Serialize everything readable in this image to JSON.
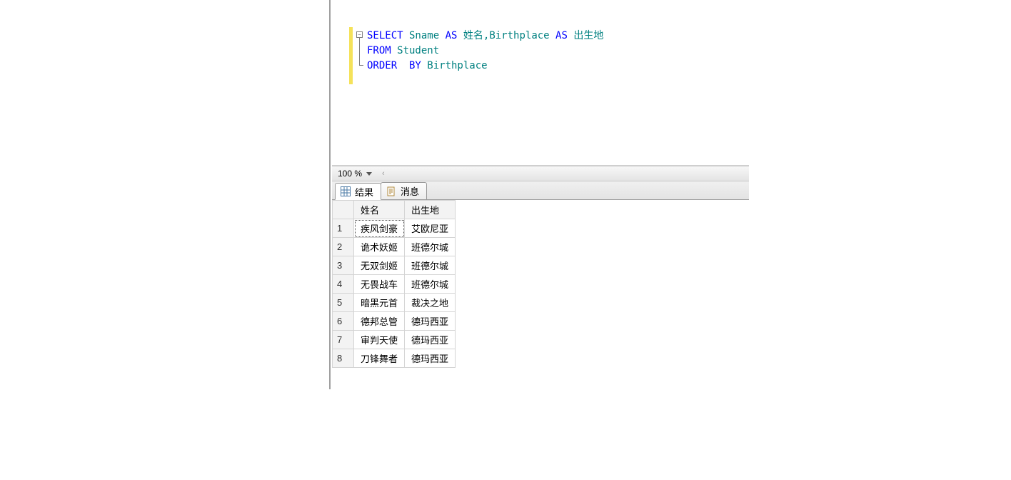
{
  "editor": {
    "fold_glyph": "−",
    "lines": [
      {
        "segments": [
          {
            "t": "SELECT",
            "c": "kw"
          },
          {
            "t": " Sname ",
            "c": "plain"
          },
          {
            "t": "AS",
            "c": "kw"
          },
          {
            "t": " 姓名",
            "c": "plain"
          },
          {
            "t": ",",
            "c": "plain"
          },
          {
            "t": "Birthplace ",
            "c": "plain"
          },
          {
            "t": "AS",
            "c": "kw"
          },
          {
            "t": " 出生地",
            "c": "plain"
          }
        ]
      },
      {
        "segments": [
          {
            "t": "FROM",
            "c": "kw"
          },
          {
            "t": " Student",
            "c": "plain"
          }
        ]
      },
      {
        "segments": [
          {
            "t": "ORDER  BY",
            "c": "kw"
          },
          {
            "t": " Birthplace",
            "c": "plain"
          }
        ]
      }
    ]
  },
  "zoom": {
    "label": "100 %"
  },
  "tabs": {
    "results": "结果",
    "messages": "消息"
  },
  "grid": {
    "columns": [
      "姓名",
      "出生地"
    ],
    "rows": [
      {
        "n": "1",
        "cells": [
          "疾风剑豪",
          "艾欧尼亚"
        ]
      },
      {
        "n": "2",
        "cells": [
          "诡术妖姬",
          "班德尔城"
        ]
      },
      {
        "n": "3",
        "cells": [
          "无双剑姬",
          "班德尔城"
        ]
      },
      {
        "n": "4",
        "cells": [
          "无畏战车",
          "班德尔城"
        ]
      },
      {
        "n": "5",
        "cells": [
          "暗黑元首",
          "裁决之地"
        ]
      },
      {
        "n": "6",
        "cells": [
          "德邦总管",
          "德玛西亚"
        ]
      },
      {
        "n": "7",
        "cells": [
          "审判天使",
          "德玛西亚"
        ]
      },
      {
        "n": "8",
        "cells": [
          "刀锋舞者",
          "德玛西亚"
        ]
      }
    ]
  }
}
